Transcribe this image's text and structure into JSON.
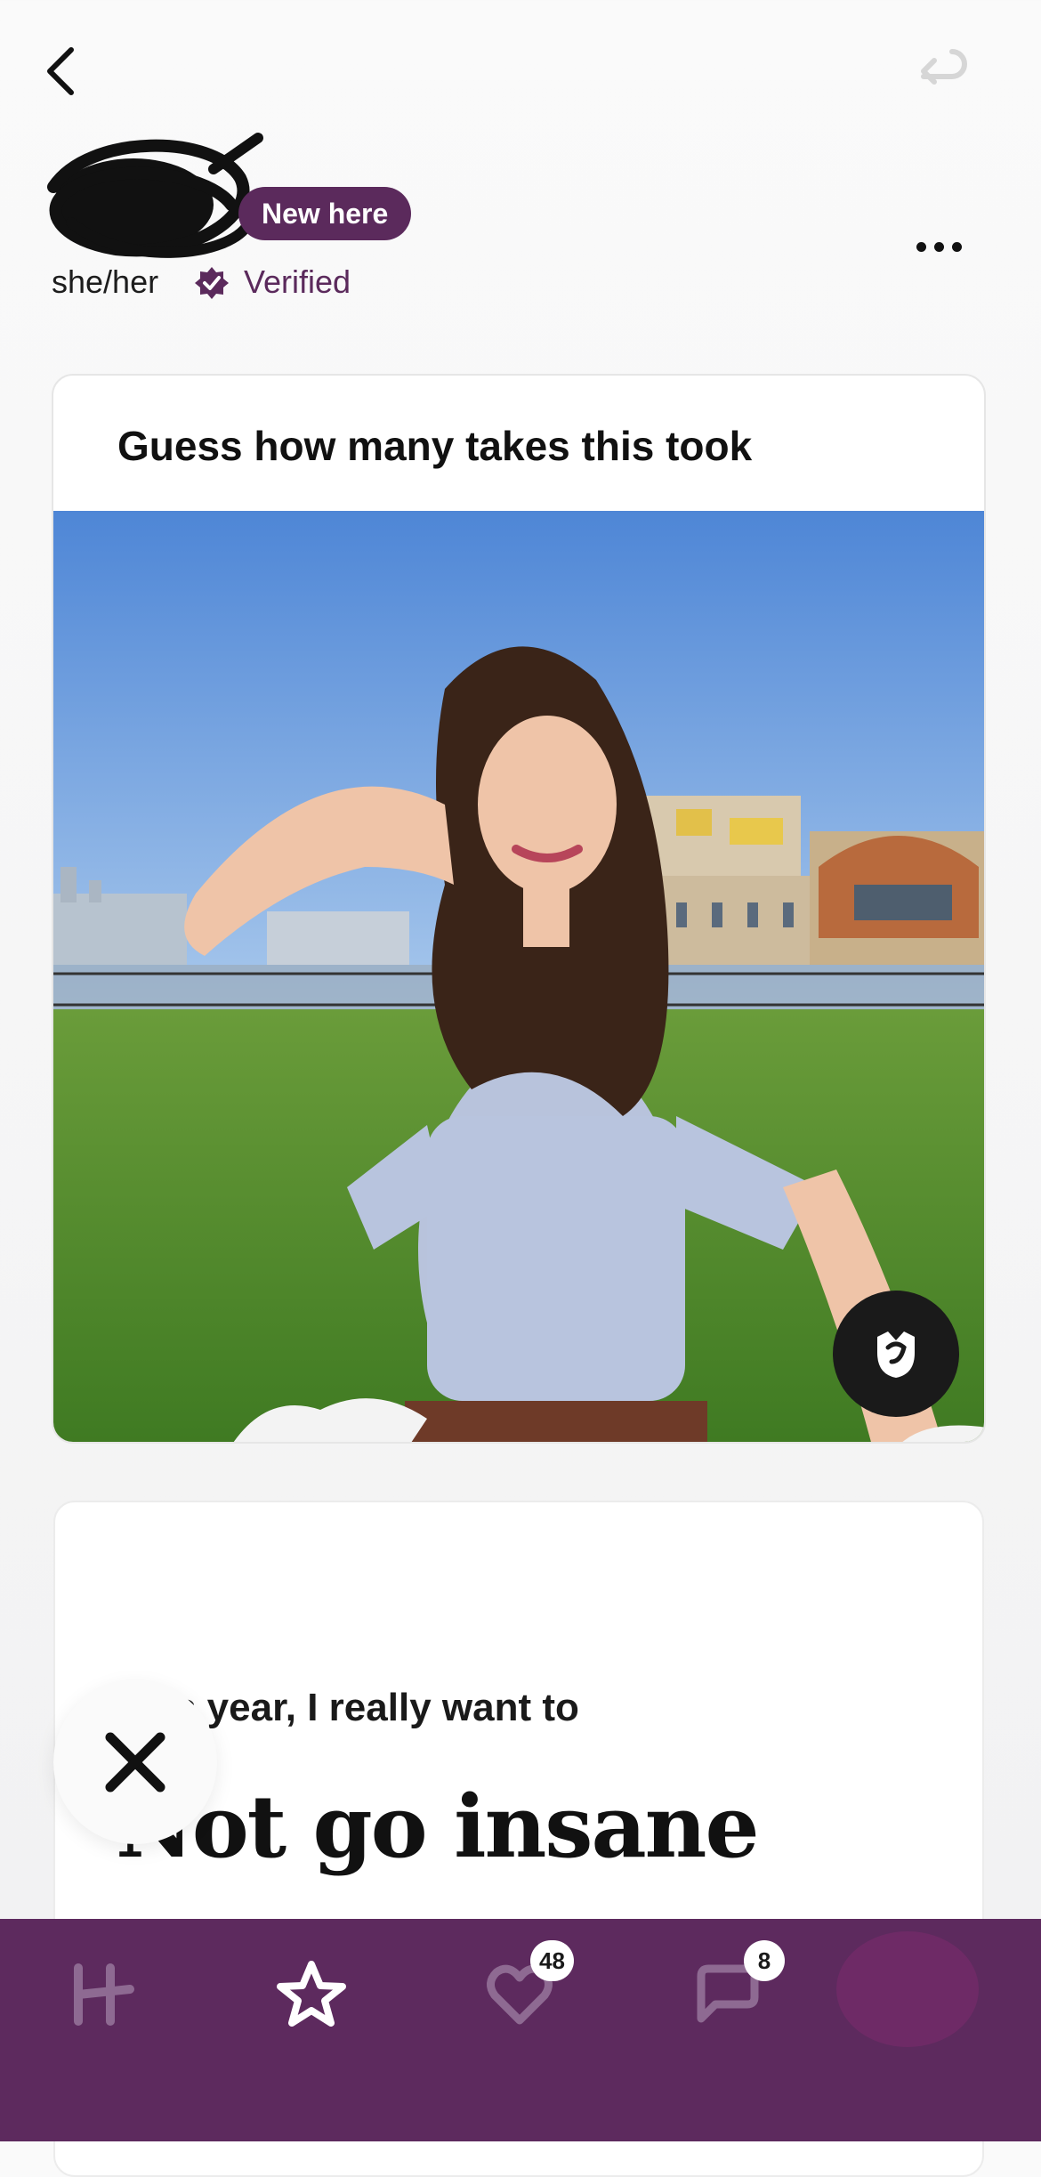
{
  "header": {
    "badge": "New here",
    "pronouns": "she/her",
    "verified": "Verified"
  },
  "photo_card": {
    "caption": "Guess how many takes this took"
  },
  "prompt_card": {
    "question": "This year, I really want to",
    "answer": "Not go insane"
  },
  "nav": {
    "likes_count": "48",
    "messages_count": "8"
  },
  "colors": {
    "brand": "#5d2a5e",
    "verified": "#5b2a5c"
  }
}
